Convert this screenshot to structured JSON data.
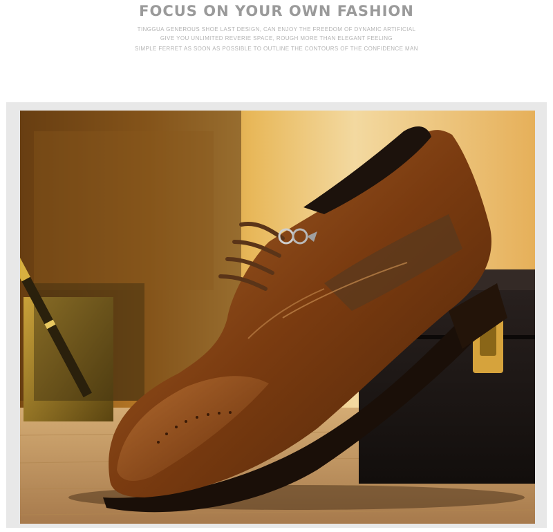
{
  "header": {
    "title": "FOCUS ON YOUR OWN FASHION",
    "description_lines": [
      "TINGGUA GENEROUS SHOE LAST DESIGN, CAN ENJOY THE FREEDOM OF DYNAMIC ARTIFICIAL",
      "GIVE YOU UNLIMITED REVERIE SPACE, ROUGH MORE THAN ELEGANT FEELING",
      "SIMPLE FERRET AS SOON AS POSSIBLE TO OUTLINE THE CONTOURS OF THE CONFIDENCE MAN"
    ]
  },
  "photo": {
    "subject": "brown leather lace-up oxford dress shoe",
    "colors": {
      "leather": "#7a3b10",
      "background_warm": "#d99a38",
      "wood_floor": "#c8a070",
      "case": "#1e1815",
      "gold": "#d6a33c"
    }
  }
}
